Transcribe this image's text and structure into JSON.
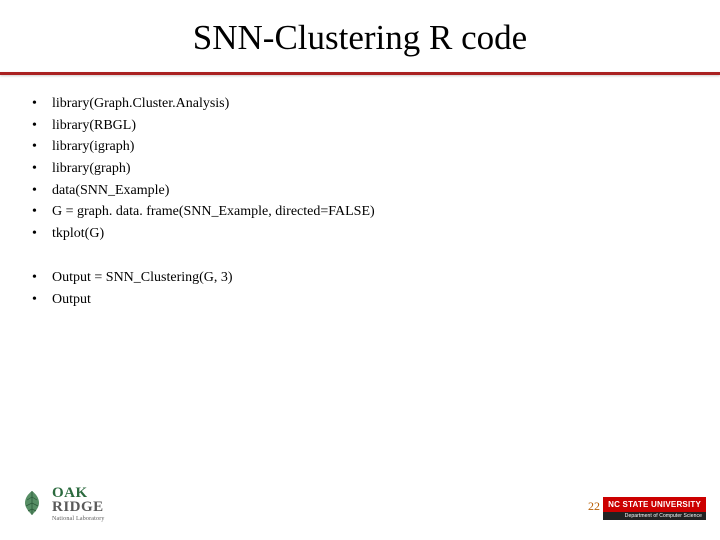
{
  "title": "SNN-Clustering R code",
  "group1": [
    "library(Graph.Cluster.Analysis)",
    "library(RBGL)",
    "library(igraph)",
    "library(graph)",
    "data(SNN_Example)",
    "G = graph. data. frame(SNN_Example, directed=FALSE)",
    "tkplot(G)"
  ],
  "group2": [
    "Output =  SNN_Clustering(G, 3)",
    "Output"
  ],
  "footer": {
    "oak_top": "OAK",
    "oak_bottom": "RIDGE",
    "oak_sub": "National Laboratory",
    "page": "22",
    "nc_main": "NC STATE UNIVERSITY",
    "nc_sub": "Department of Computer Science"
  }
}
